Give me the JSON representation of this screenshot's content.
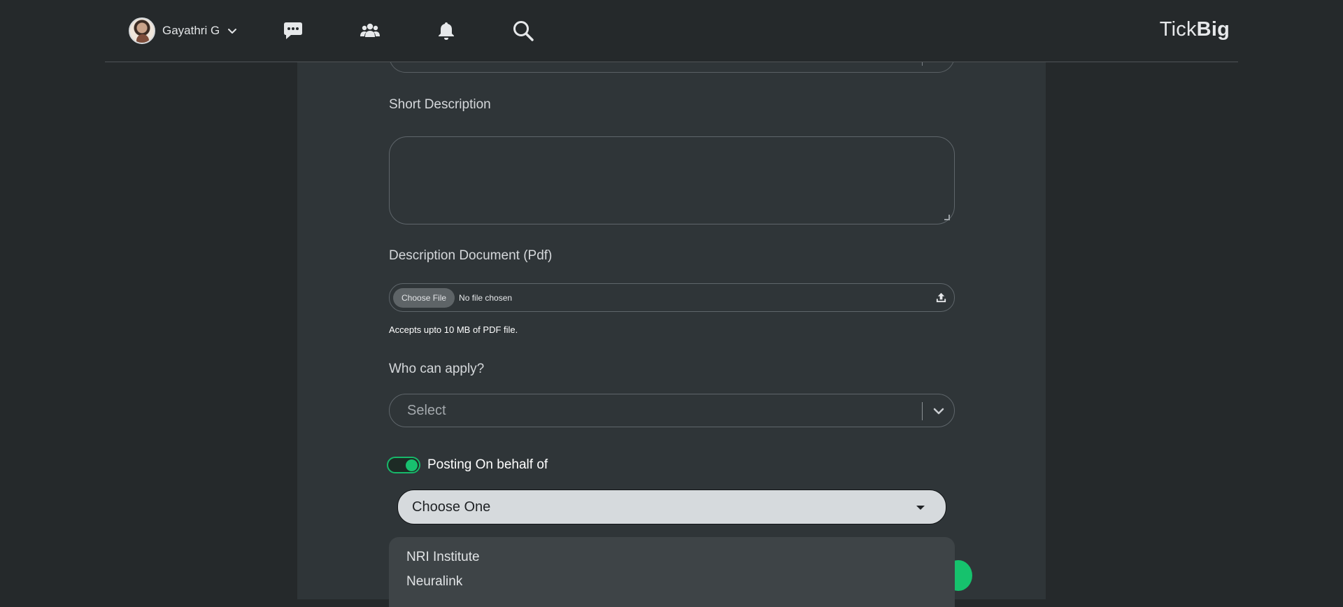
{
  "header": {
    "user_name": "Gayathri G",
    "brand_light": "Tick",
    "brand_bold": "Big",
    "icons": [
      "avatar",
      "chevron-down-icon",
      "chat-icon",
      "users-icon",
      "bell-icon",
      "search-icon"
    ]
  },
  "form": {
    "short_description_label": "Short Description",
    "short_description_value": "",
    "document_label": "Description Document (Pdf)",
    "choose_file_label": "Choose File",
    "no_file_text": "No file chosen",
    "document_help": "Accepts upto 10 MB of PDF file.",
    "who_can_apply_label": "Who can apply?",
    "who_can_apply_placeholder": "Select",
    "posting_on_behalf_label": "Posting On behalf of",
    "posting_on_behalf_enabled": true,
    "organization_select_value": "Choose One",
    "organization_options": [
      "NRI Institute",
      "Neuralink"
    ]
  },
  "colors": {
    "background": "#25292b",
    "panel": "#2f3538",
    "accent_green": "#18c16f",
    "select_light": "#d6dadd"
  }
}
